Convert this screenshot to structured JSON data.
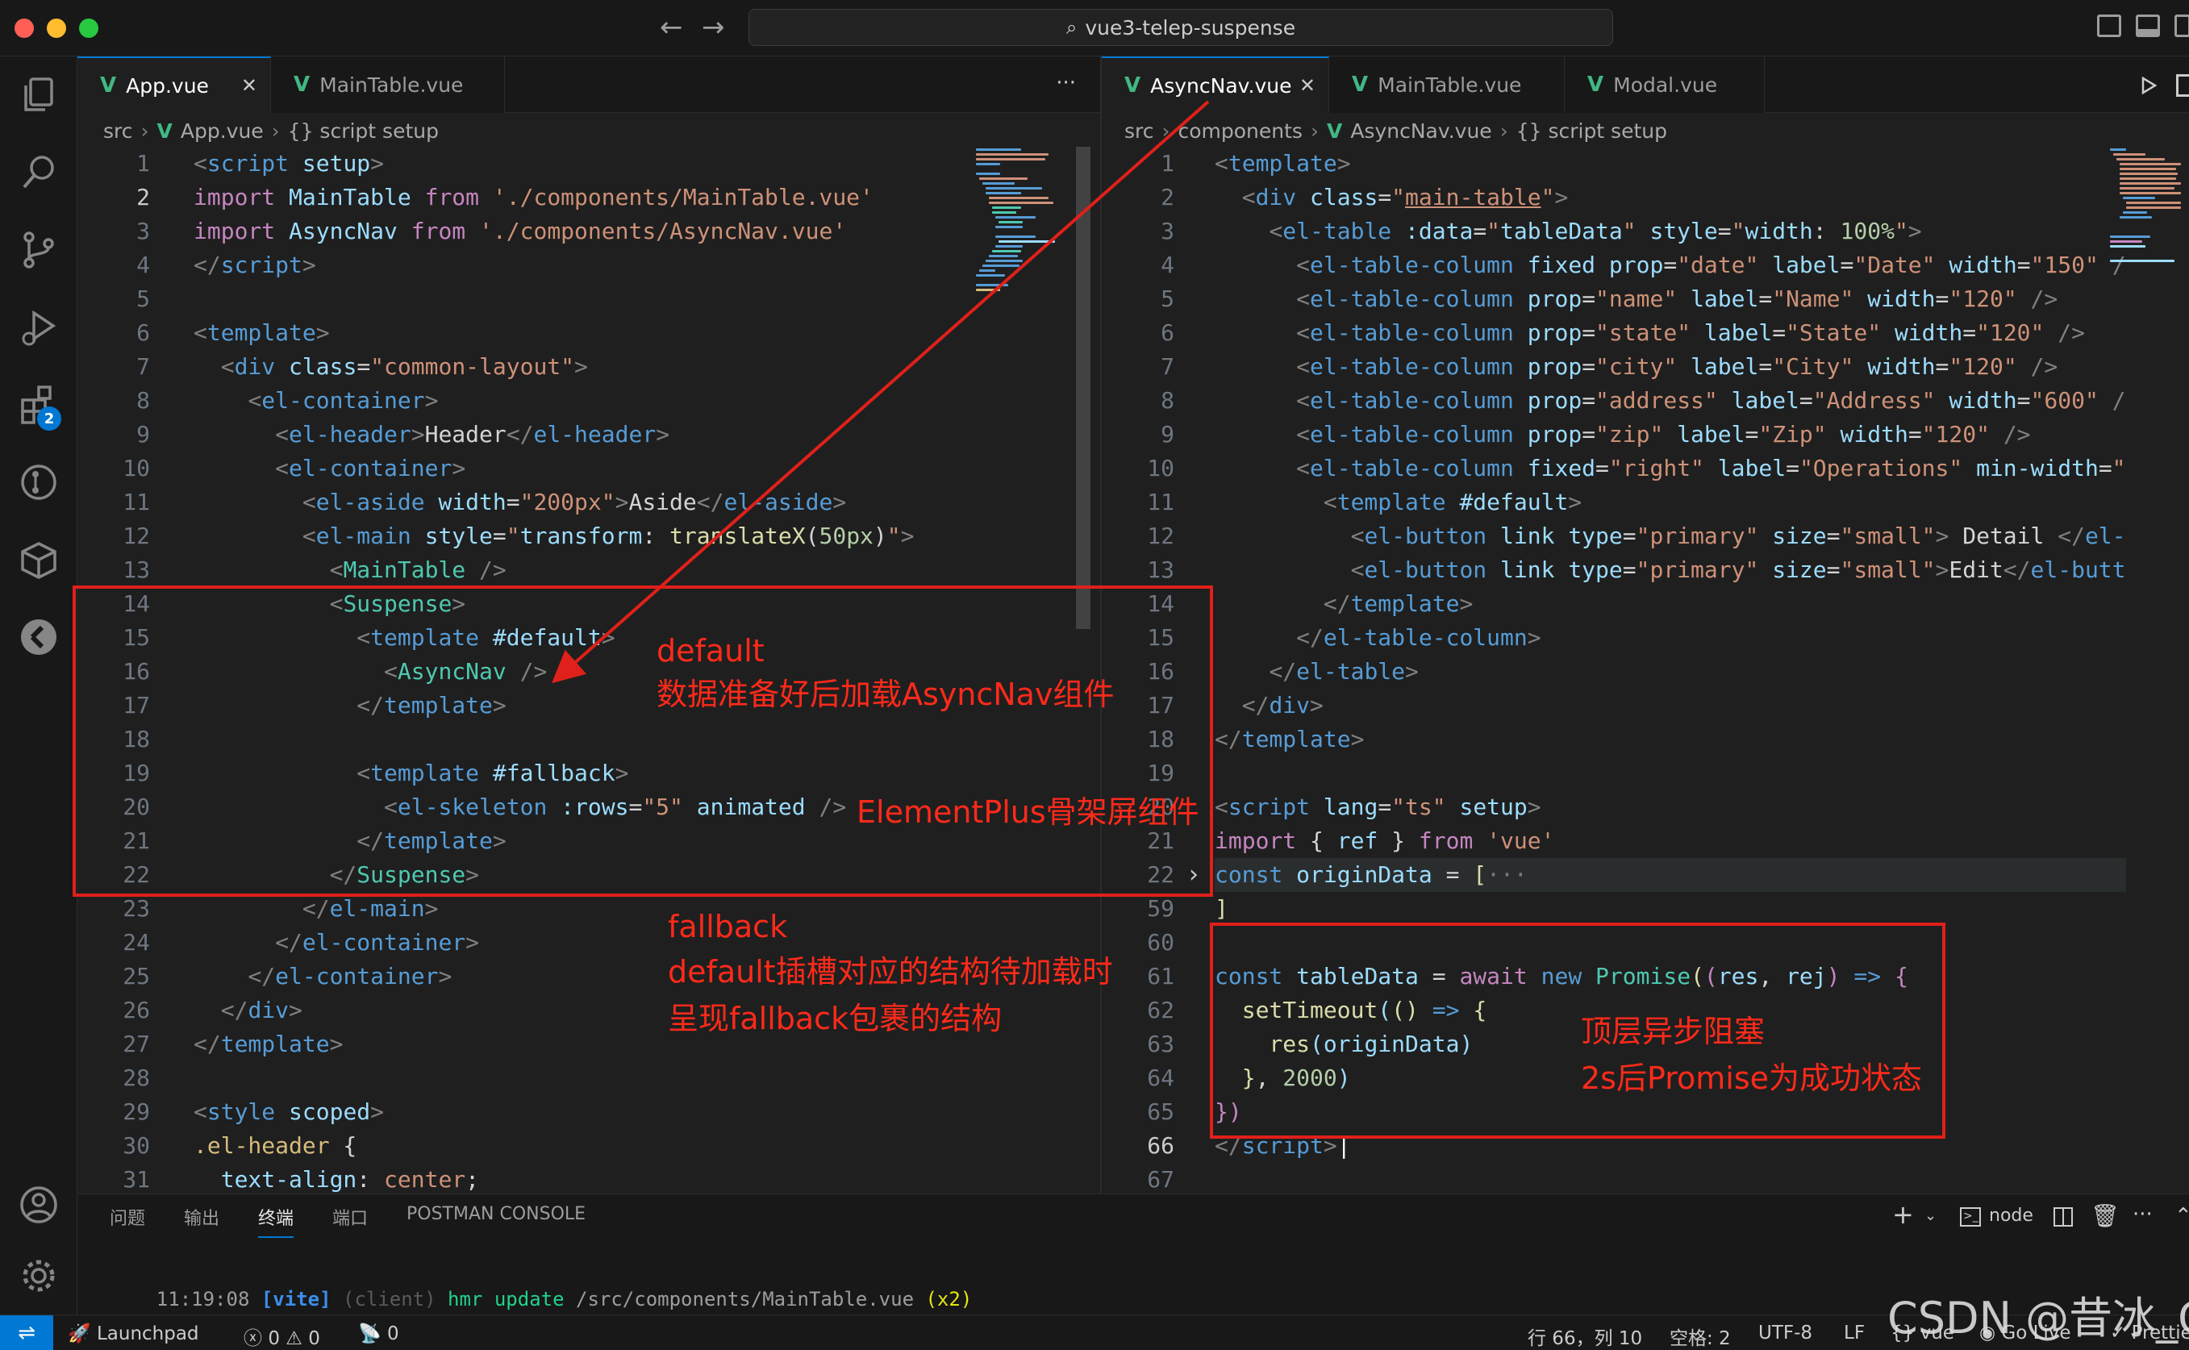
{
  "window": {
    "search_text": "vue3-telep-suspense"
  },
  "activity_bar": {
    "extensions_badge": "2"
  },
  "left_editor": {
    "tabs": [
      {
        "label": "App.vue",
        "active": true
      },
      {
        "label": "MainTable.vue",
        "active": false
      }
    ],
    "more": "···",
    "breadcrumb": {
      "folder": "src",
      "file": "App.vue",
      "symbol": "{} script setup"
    },
    "line_numbers": [
      "1",
      "2",
      "3",
      "4",
      "5",
      "6",
      "7",
      "8",
      "9",
      "10",
      "11",
      "12",
      "13",
      "14",
      "15",
      "16",
      "17",
      "18",
      "19",
      "20",
      "21",
      "22",
      "23",
      "24",
      "25",
      "26",
      "27",
      "28",
      "29",
      "30",
      "31"
    ],
    "current_line": "2"
  },
  "right_editor": {
    "tabs": [
      {
        "label": "AsyncNav.vue",
        "active": true
      },
      {
        "label": "MainTable.vue",
        "active": false
      },
      {
        "label": "Modal.vue",
        "active": false
      }
    ],
    "breadcrumb": {
      "folder": "src",
      "subfolder": "components",
      "file": "AsyncNav.vue",
      "symbol": "{} script setup"
    },
    "line_numbers": [
      "1",
      "2",
      "3",
      "4",
      "5",
      "6",
      "7",
      "8",
      "9",
      "10",
      "11",
      "12",
      "13",
      "14",
      "15",
      "16",
      "17",
      "18",
      "19",
      "20",
      "21",
      "22",
      "59",
      "60",
      "61",
      "62",
      "63",
      "64",
      "65",
      "66",
      "67"
    ],
    "current_line": "66",
    "fold_marker": "›"
  },
  "panel": {
    "tabs": [
      "问题",
      "输出",
      "终端",
      "端口",
      "POSTMAN CONSOLE"
    ],
    "active_tab": "终端",
    "terminal_time": "11:19:08",
    "terminal_tag": "[vite]",
    "terminal_client": "(client)",
    "terminal_hmr": "hmr update",
    "terminal_path": "/src/components/MainTable.vue",
    "terminal_count": "(x2)",
    "terminal_cursor": "▯",
    "shell_name": "node"
  },
  "status_bar": {
    "launchpad": "Launchpad",
    "errors": "0",
    "warnings": "0",
    "ports": "0",
    "position": "行 66，列 10",
    "spaces": "空格: 2",
    "encoding": "UTF-8",
    "eol": "LF",
    "language": "vue",
    "golive": "Go Live",
    "prettier": "Prettier"
  },
  "annotations": {
    "default_title": "default",
    "default_desc": "数据准备好后加载AsyncNav组件",
    "skeleton_desc": "ElementPlus骨架屏组件",
    "fallback_title": "fallback",
    "fallback_desc1": "default插槽对应的结构待加载时",
    "fallback_desc2": "呈现fallback包裹的结构",
    "toplevel_title": "顶层异步阻塞",
    "toplevel_desc": "2s后Promise为成功状态"
  },
  "watermark": "CSDN @昔冰_G",
  "colors": {
    "accent": "#0078d4",
    "annotation_red": "#e0201a",
    "editor_bg": "#1f1f1f"
  }
}
